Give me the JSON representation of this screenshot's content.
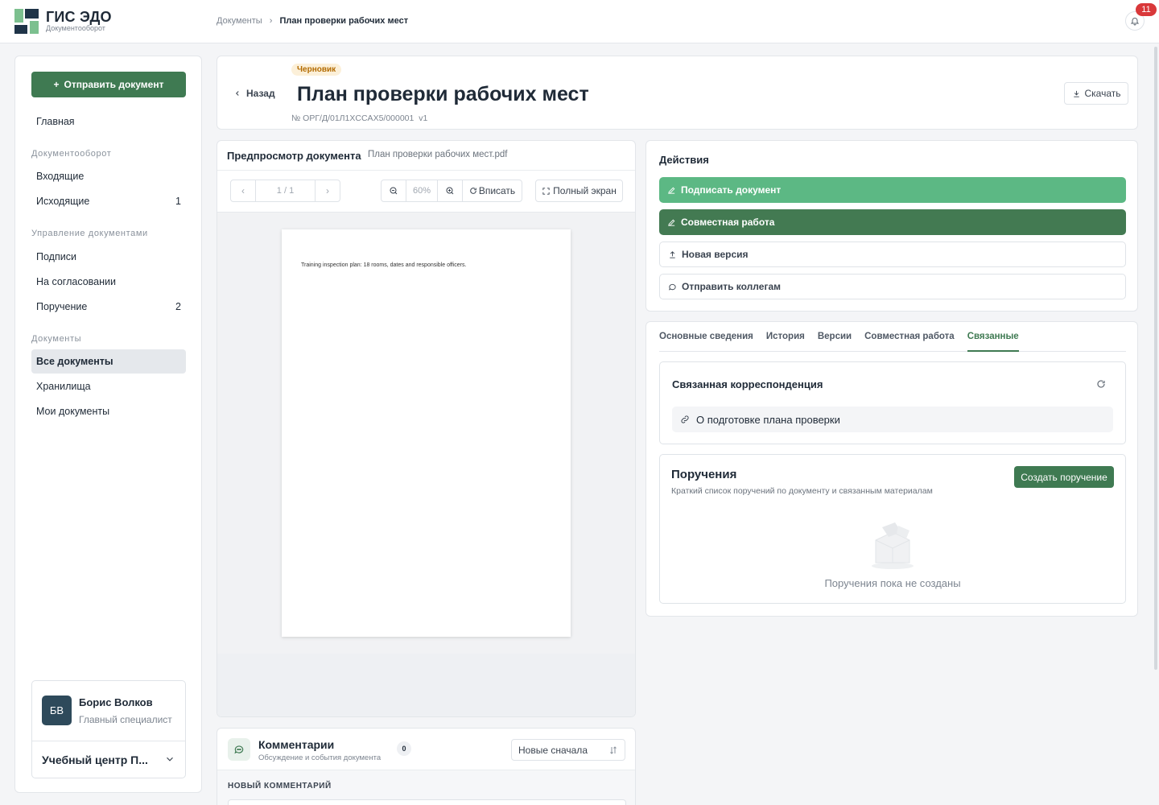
{
  "brand": {
    "title": "ГИС ЭДО",
    "subtitle": "Документооборот"
  },
  "breadcrumb": {
    "parent": "Документы",
    "separator": "›",
    "current": "План проверки рабочих мест"
  },
  "notifications": {
    "count": "11"
  },
  "sidebar": {
    "send_button": "Отправить документ",
    "home": "Главная",
    "sections": [
      {
        "title": "Документооборот",
        "items": [
          {
            "label": "Входящие",
            "count": ""
          },
          {
            "label": "Исходящие",
            "count": "1"
          }
        ]
      },
      {
        "title": "Управление документами",
        "items": [
          {
            "label": "Подписи",
            "count": ""
          },
          {
            "label": "На согласовании",
            "count": ""
          },
          {
            "label": "Поручение",
            "count": "2"
          }
        ]
      },
      {
        "title": "Документы",
        "items": [
          {
            "label": "Все документы",
            "count": ""
          },
          {
            "label": "Хранилища",
            "count": ""
          },
          {
            "label": "Мои документы",
            "count": ""
          }
        ]
      }
    ],
    "user": {
      "initials": "БВ",
      "name": "Борис Волков",
      "role": "Главный специалист",
      "org": "Учебный центр П..."
    }
  },
  "header": {
    "back": "Назад",
    "status": "Черновик",
    "title": "План проверки рабочих мест",
    "number": "№ ОРГ/Д/01Л1XCCAX5/000001",
    "version": "v1",
    "download": "Скачать"
  },
  "preview": {
    "title": "Предпросмотр документа",
    "filename": "План проверки рабочих мест.pdf",
    "page": "1 / 1",
    "zoom": "60%",
    "fit": "Вписать",
    "fullscreen": "Полный экран",
    "page_text": "Training inspection plan: 18 rooms, dates and responsible officers."
  },
  "comments": {
    "title": "Комментарии",
    "subtitle": "Обсуждение и события документа",
    "count": "0",
    "sort": "Новые сначала",
    "new_label": "НОВЫЙ КОММЕНТАРИЙ"
  },
  "actions": {
    "title": "Действия",
    "sign": "Подписать документ",
    "collab": "Совместная работа",
    "new_version": "Новая версия",
    "send_colleagues": "Отправить коллегам"
  },
  "tabs": [
    "Основные сведения",
    "История",
    "Версии",
    "Совместная работа",
    "Связанные"
  ],
  "related": {
    "title": "Связанная корреспонденция",
    "items": [
      "О подготовке плана проверки"
    ]
  },
  "tasks": {
    "title": "Поручения",
    "subtitle": "Краткий список поручений по документу и связанным материалам",
    "create": "Создать поручение",
    "empty": "Поручения пока не созданы"
  },
  "colors": {
    "accent": "#3f7a52",
    "accent_light": "#5cb884",
    "badge": "#d9383a",
    "avatar": "#2e4a5b"
  }
}
